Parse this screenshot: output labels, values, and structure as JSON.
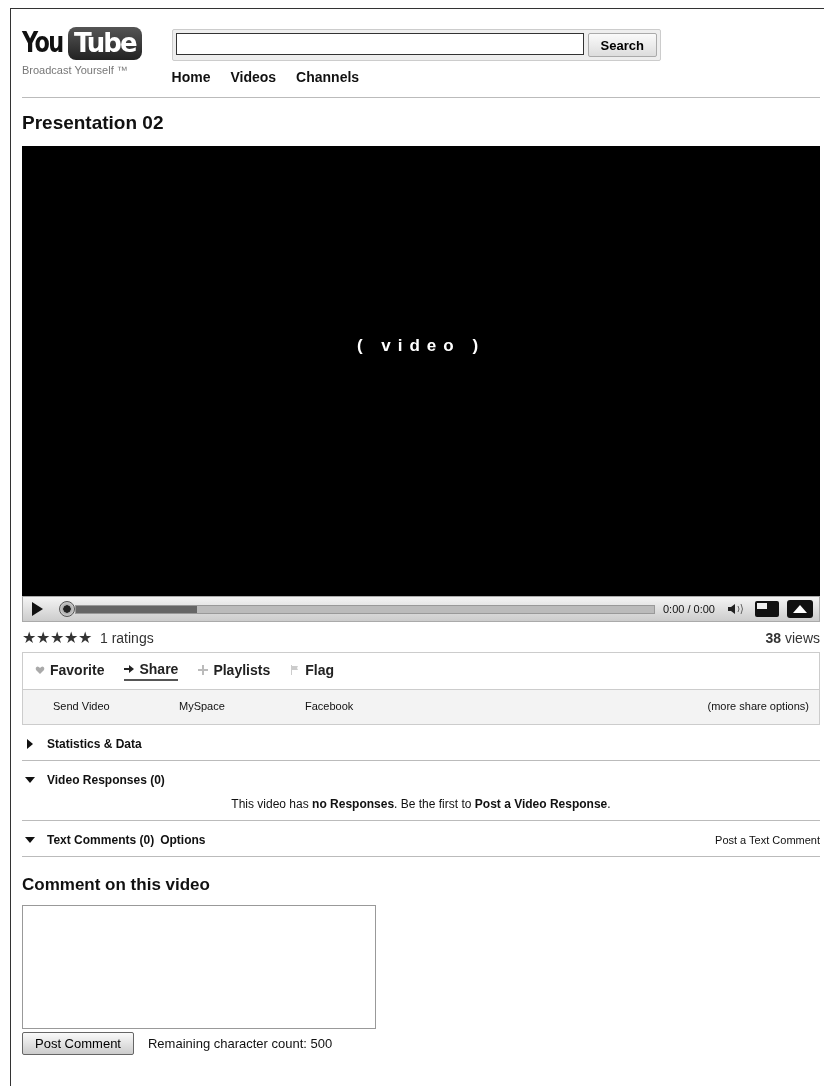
{
  "logo": {
    "word_1": "You",
    "word_2": "Tube",
    "tagline": "Broadcast Yourself ™"
  },
  "search": {
    "button": "Search"
  },
  "nav": [
    "Home",
    "Videos",
    "Channels"
  ],
  "title": "Presentation 02",
  "player": {
    "overlay": "( video )",
    "progress": {
      "level": 0.21
    },
    "time": "0:00 / 0:00"
  },
  "rating": {
    "stars": 5,
    "count": "1 ratings",
    "views_number": "38",
    "views_label": "views"
  },
  "action_tabs": [
    {
      "label": "Favorite",
      "kind": "heart",
      "selected": false
    },
    {
      "label": "Share",
      "kind": "arrow",
      "selected": true
    },
    {
      "label": "Playlists",
      "kind": "plus",
      "selected": false
    },
    {
      "label": "Flag",
      "kind": "flag",
      "selected": false
    }
  ],
  "share_links": [
    "Send Video",
    "MySpace",
    "Facebook"
  ],
  "more_share": "(more share options)",
  "sections": [
    {
      "title": "Statistics & Data",
      "expanded": false
    },
    {
      "title": "Video Responses (0)",
      "expanded": true,
      "text": "This video has **no Responses**. Be the first to **Post a Video Response**."
    },
    {
      "title": "Text Comments (0)",
      "expanded": true,
      "options": "Options",
      "link": "Post a Text Comment"
    }
  ],
  "comment": {
    "heading": "Comment on this video",
    "button": "Post Comment",
    "remaining": "Remaining character count: 500"
  }
}
